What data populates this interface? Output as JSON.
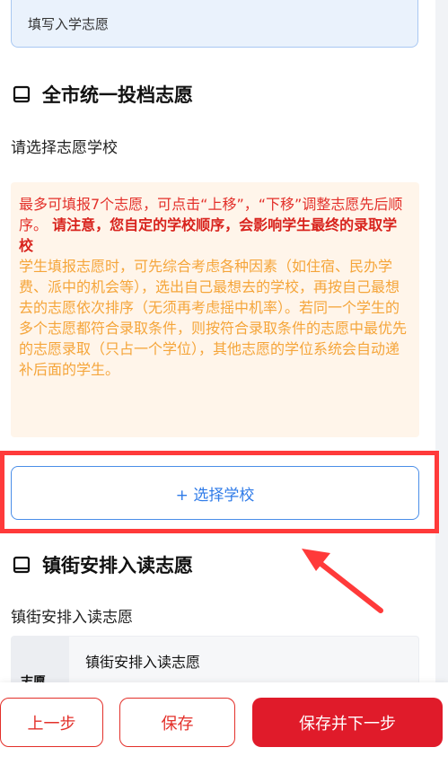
{
  "top_field": {
    "value": "填写入学志愿"
  },
  "section1": {
    "title": "全市统一投档志愿",
    "sub_label": "请选择志愿学校"
  },
  "notice": {
    "red_text": "最多可填报7个志愿，可点击“上移”，“下移”调整志愿先后顺序。",
    "red_bold_text": "请注意，您自定的学校顺序，会影响学生最终的录取学校",
    "orange_text": "学生填报志愿时，可先综合考虑各种因素（如住宿、民办学费、派中的机会等），选出自己最想去的学校，再按自己最想去的志愿依次排序（无须再考虑摇中机率）。若同一个学生的多个志愿都符合录取条件，则按符合录取条件的志愿中最优先的志愿录取（只占一个学位），其他志愿的学位系统会自动递补后面的学生。"
  },
  "choose_school_button": {
    "label": "+ 选择学校"
  },
  "section2": {
    "title": "镇街安排入读志愿",
    "sub_label": "镇街安排入读志愿"
  },
  "card": {
    "thumb_label": "志愿",
    "title": "镇街安排入读志愿"
  },
  "buttons": {
    "prev": "上一步",
    "save": "保存",
    "save_next": "保存并下一步"
  },
  "icons": {
    "section_icon": "book-icon",
    "annotation_arrow": "arrow-icon"
  },
  "colors": {
    "accent_blue": "#2f7be8",
    "primary_red": "#e01b2a",
    "highlight": "#ff3a3a",
    "notice_orange": "#f5a53a"
  }
}
